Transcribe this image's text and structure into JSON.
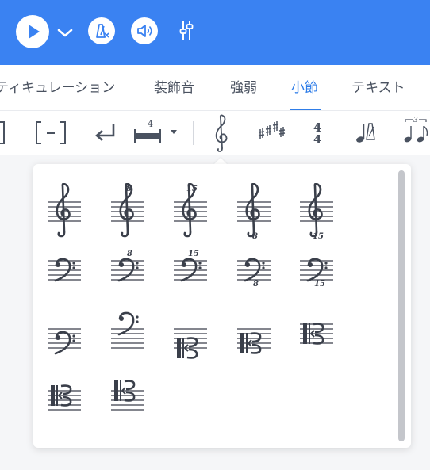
{
  "header": {
    "buttons": [
      {
        "name": "play-button",
        "icon": "play-icon"
      },
      {
        "name": "play-options-button",
        "icon": "chevron-down-icon"
      },
      {
        "name": "metronome-button",
        "icon": "metronome-off-icon"
      },
      {
        "name": "playback-sound-button",
        "icon": "speaker-icon"
      },
      {
        "name": "mixer-button",
        "icon": "mixer-sliders-icon"
      }
    ],
    "accent_color": "#3a82f2"
  },
  "tabs": [
    {
      "label": "ティキュレーション",
      "active": false
    },
    {
      "label": "装飾音",
      "active": false
    },
    {
      "label": "強弱",
      "active": false
    },
    {
      "label": "小節",
      "active": true
    },
    {
      "label": "テキスト",
      "active": false
    }
  ],
  "toolbar": {
    "tools": [
      {
        "name": "bracket-tool",
        "icon": "bracket-icon"
      },
      {
        "name": "repeat-bracket-tool",
        "icon": "dashed-bracket-icon"
      },
      {
        "name": "line-break-tool",
        "icon": "return-arrow-icon"
      },
      {
        "name": "measure-count-tool",
        "icon": "measure-icon",
        "label": "4"
      },
      {
        "name": "clef-tool",
        "icon": "treble-clef-icon",
        "active": true
      },
      {
        "name": "key-signature-tool",
        "icon": "sharps-icon"
      },
      {
        "name": "time-signature-tool",
        "icon": "time-signature-icon",
        "top": "4",
        "bottom": "4"
      },
      {
        "name": "tempo-tool",
        "icon": "metronome-note-icon"
      },
      {
        "name": "tuplet-tool",
        "icon": "tuplet-icon",
        "label": "3"
      }
    ]
  },
  "clef_panel": {
    "items": [
      {
        "name": "treble-clef",
        "type": "treble",
        "octave": ""
      },
      {
        "name": "treble-8va-clef",
        "type": "treble",
        "octave": "8",
        "pos": "above"
      },
      {
        "name": "treble-15ma-clef",
        "type": "treble",
        "octave": "15",
        "pos": "above"
      },
      {
        "name": "treble-8vb-clef",
        "type": "treble",
        "octave": "8",
        "pos": "below"
      },
      {
        "name": "treble-15mb-clef",
        "type": "treble",
        "octave": "15",
        "pos": "below"
      },
      {
        "name": "bass-clef",
        "type": "bass",
        "octave": ""
      },
      {
        "name": "bass-8va-clef",
        "type": "bass",
        "octave": "8",
        "pos": "above"
      },
      {
        "name": "bass-15ma-clef",
        "type": "bass",
        "octave": "15",
        "pos": "above"
      },
      {
        "name": "bass-8vb-clef",
        "type": "bass",
        "octave": "8",
        "pos": "below"
      },
      {
        "name": "bass-15mb-clef",
        "type": "bass",
        "octave": "15",
        "pos": "below"
      },
      {
        "name": "baritone-f-clef",
        "type": "bass-low",
        "octave": ""
      },
      {
        "name": "subbass-clef",
        "type": "bass-high",
        "octave": ""
      },
      {
        "name": "soprano-c-clef",
        "type": "c1",
        "octave": ""
      },
      {
        "name": "mezzo-c-clef",
        "type": "c2",
        "octave": ""
      },
      {
        "name": "alto-c-clef",
        "type": "c3",
        "octave": ""
      },
      {
        "name": "tenor-c-clef",
        "type": "c4",
        "octave": ""
      },
      {
        "name": "baritone-c-clef",
        "type": "c5",
        "octave": ""
      }
    ]
  }
}
